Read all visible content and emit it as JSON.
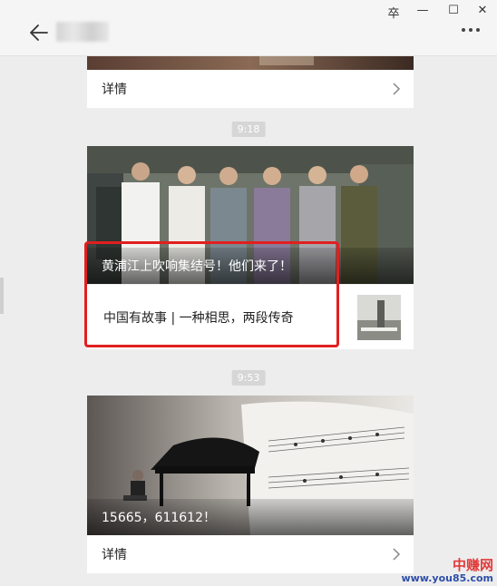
{
  "window": {
    "pin_glyph": "卒",
    "minimize_glyph": "—",
    "maximize_glyph": "☐",
    "close_glyph": "✕"
  },
  "header": {
    "back_icon": "arrow-left-icon",
    "more_icon": "ellipsis-icon"
  },
  "feed": {
    "card1": {
      "detail_label": "详情"
    },
    "time1": "9:18",
    "card2": {
      "title": "黄浦江上吹响集结号！他们来了！",
      "sub_title": "中国有故事 | 一种相思，两段传奇"
    },
    "time2": "9:53",
    "card3": {
      "title": "15665，611612！",
      "detail_label": "详情"
    }
  },
  "watermark": {
    "name": "中赚网",
    "url": "www.you85.com"
  },
  "colors": {
    "highlight": "#e21f1f",
    "background": "#ededed"
  }
}
